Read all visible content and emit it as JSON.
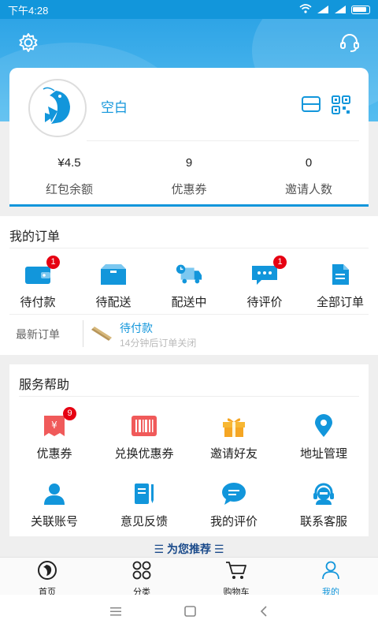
{
  "status_bar": {
    "time": "下午4:28"
  },
  "profile": {
    "username": "空白",
    "stats": [
      {
        "value": "¥4.5",
        "label": "红包余额"
      },
      {
        "value": "9",
        "label": "优惠券"
      },
      {
        "value": "0",
        "label": "邀请人数"
      }
    ]
  },
  "orders": {
    "title": "我的订单",
    "items": [
      {
        "label": "待付款",
        "icon": "wallet-icon",
        "badge": "1"
      },
      {
        "label": "待配送",
        "icon": "box-icon",
        "badge": ""
      },
      {
        "label": "配送中",
        "icon": "truck-icon",
        "badge": ""
      },
      {
        "label": "待评价",
        "icon": "comment-icon",
        "badge": "1"
      },
      {
        "label": "全部订单",
        "icon": "document-icon",
        "badge": ""
      }
    ],
    "latest": {
      "label": "最新订单",
      "status": "待付款",
      "note": "14分钟后订单关闭"
    }
  },
  "services": {
    "title": "服务帮助",
    "items": [
      {
        "label": "优惠券",
        "icon": "coupon-icon",
        "badge": "9"
      },
      {
        "label": "兑换优惠券",
        "icon": "barcode-icon",
        "badge": ""
      },
      {
        "label": "邀请好友",
        "icon": "gift-icon",
        "badge": ""
      },
      {
        "label": "地址管理",
        "icon": "location-icon",
        "badge": ""
      },
      {
        "label": "关联账号",
        "icon": "user-icon",
        "badge": ""
      },
      {
        "label": "意见反馈",
        "icon": "notebook-icon",
        "badge": ""
      },
      {
        "label": "我的评价",
        "icon": "chat-icon",
        "badge": ""
      },
      {
        "label": "联系客服",
        "icon": "headset-icon",
        "badge": ""
      }
    ]
  },
  "recommend": {
    "title": "为您推荐"
  },
  "tabbar": {
    "items": [
      {
        "label": "首页",
        "icon": "home-logo-icon",
        "active": false
      },
      {
        "label": "分类",
        "icon": "category-icon",
        "active": false
      },
      {
        "label": "购物车",
        "icon": "cart-icon",
        "active": false
      },
      {
        "label": "我的",
        "icon": "profile-icon",
        "active": true
      }
    ]
  },
  "colors": {
    "primary": "#1296db",
    "badge": "#e60012",
    "coupon": "#f05a5a",
    "gift": "#f5a623"
  }
}
